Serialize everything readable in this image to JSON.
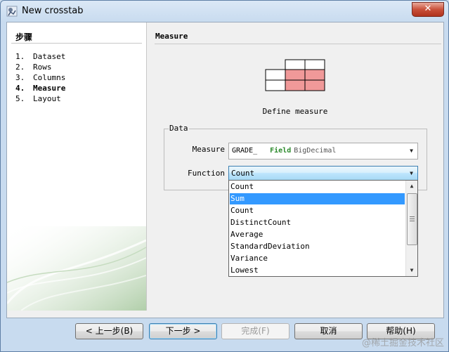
{
  "window": {
    "title": "New crosstab",
    "close_label": "✕"
  },
  "steps": {
    "title": "步骤",
    "items": [
      {
        "num": "1.",
        "label": "Dataset"
      },
      {
        "num": "2.",
        "label": "Rows"
      },
      {
        "num": "3.",
        "label": "Columns"
      },
      {
        "num": "4.",
        "label": "Measure"
      },
      {
        "num": "5.",
        "label": "Layout"
      }
    ],
    "active_index": 3
  },
  "page": {
    "title": "Measure",
    "illustration_caption": "Define measure",
    "group_label": "Data",
    "measure_label": "Measure",
    "measure_value": {
      "name": "GRADE_",
      "kind": "Field",
      "type": "BigDecimal"
    },
    "function_label": "Function",
    "function_value": "Count",
    "function_options": [
      "Count",
      "Sum",
      "Count",
      "DistinctCount",
      "Average",
      "StandardDeviation",
      "Variance",
      "Lowest"
    ],
    "highlighted_option_index": 1
  },
  "buttons": {
    "back": "< 上一步(B)",
    "next": "下一步 >",
    "finish": "完成(F)",
    "cancel": "取消",
    "help": "帮助(H)"
  },
  "watermark": "@稀土掘金技术社区",
  "colors": {
    "highlight": "#3399ff",
    "cell_fill": "#f09999",
    "field_green": "#2b8a2b"
  }
}
